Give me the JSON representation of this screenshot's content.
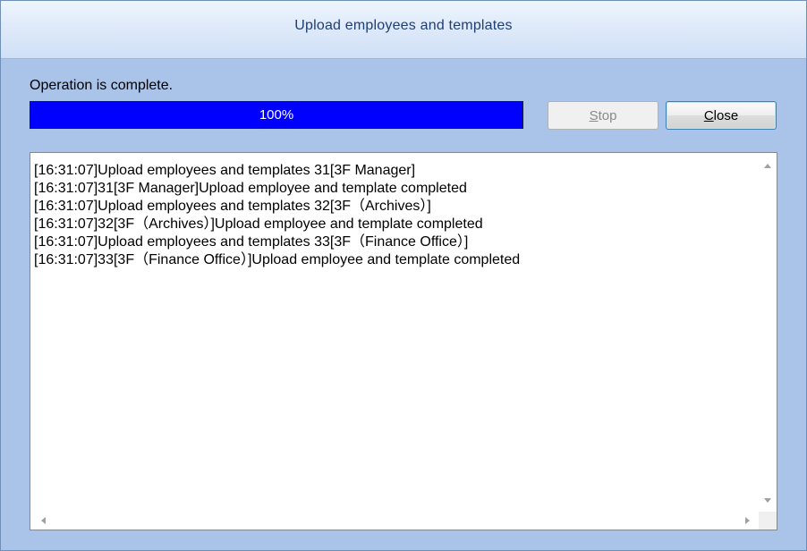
{
  "window": {
    "title": "Upload employees and templates"
  },
  "status": {
    "text": "Operation is complete."
  },
  "progress": {
    "value": 100,
    "label": "100%"
  },
  "buttons": {
    "stop_label": "Stop",
    "close_label": "Close"
  },
  "log": {
    "lines": [
      "[16:31:07]Upload employees and templates 31[3F Manager]",
      "[16:31:07]31[3F Manager]Upload employee and template completed",
      "[16:31:07]Upload employees and templates 32[3F（Archives）]",
      "[16:31:07]32[3F（Archives）]Upload employee and template completed",
      "[16:31:07]Upload employees and templates 33[3F（Finance Office）]",
      "[16:31:07]33[3F（Finance Office）]Upload employee and template completed"
    ]
  },
  "icons": {
    "scroll_up": "chevron-up-icon",
    "scroll_down": "chevron-down-icon",
    "scroll_left": "chevron-left-icon",
    "scroll_right": "chevron-right-icon"
  },
  "colors": {
    "progress_fill": "#0000ff",
    "window_background": "#a9c4e8",
    "title_text": "#1e3f74"
  }
}
